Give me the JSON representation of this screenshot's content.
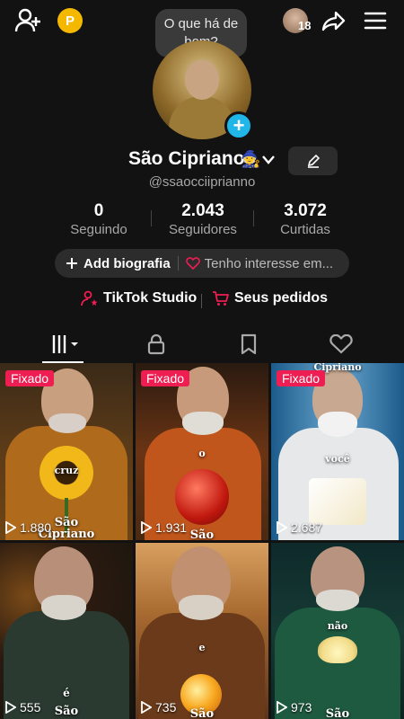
{
  "header": {
    "bubble_text": "O que há de bom?",
    "story_count": "18",
    "coin_letter": "P",
    "icons": [
      "add-friend-icon",
      "coin-icon",
      "share-icon",
      "menu-icon"
    ]
  },
  "profile": {
    "name": "São Cipriano",
    "emoji": "🧙",
    "handle": "@ssaocciiprianno",
    "avatar_badge": "+"
  },
  "stats": [
    {
      "value": "0",
      "label": "Seguindo"
    },
    {
      "value": "2.043",
      "label": "Seguidores"
    },
    {
      "value": "3.072",
      "label": "Curtidas"
    }
  ],
  "bio": {
    "add_label": "Add biografia",
    "interest_label": "Tenho interesse em..."
  },
  "links": {
    "studio": "TikTok Studio",
    "orders": "Seus pedidos"
  },
  "colors": {
    "background": "#121212",
    "accent_blue": "#20b6e8",
    "pinned_red": "#ee1d52",
    "coin_gold": "#f5b800",
    "studio_pink": "#ee1d52"
  },
  "videos": [
    {
      "pinned": "Fixado",
      "views": "1.880",
      "captions": [
        "cruz",
        "São",
        "Cipriano"
      ]
    },
    {
      "pinned": "Fixado",
      "views": "1.931",
      "captions": [
        "o",
        "São"
      ]
    },
    {
      "pinned": "Fixado",
      "views": "2.687",
      "captions": [
        "Cipriano",
        "você"
      ]
    },
    {
      "pinned": "",
      "views": "555",
      "captions": [
        "é",
        "São"
      ]
    },
    {
      "pinned": "",
      "views": "735",
      "captions": [
        "e",
        "São"
      ]
    },
    {
      "pinned": "",
      "views": "973",
      "captions": [
        "não",
        "São"
      ]
    }
  ]
}
